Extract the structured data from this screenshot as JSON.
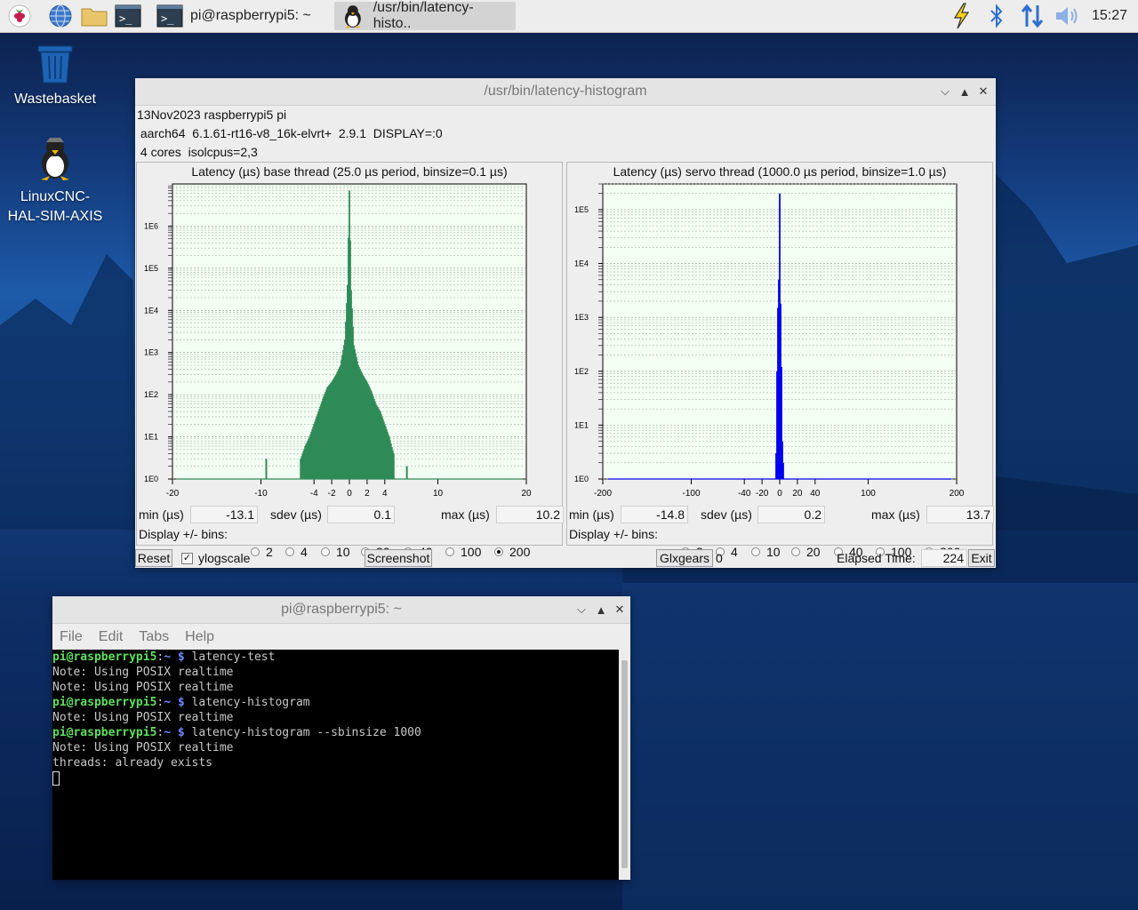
{
  "taskbar": {
    "terminal_task_label": "pi@raspberrypi5: ~",
    "histogram_task_label": "/usr/bin/latency-histo..",
    "clock": "15:27",
    "tray_icons": [
      "lightning-icon",
      "bluetooth-icon",
      "network-icon",
      "volume-icon"
    ]
  },
  "desktop": {
    "wastebasket_label": "Wastebasket",
    "linuxcnc_label_line1": "LinuxCNC-",
    "linuxcnc_label_line2": "HAL-SIM-AXIS"
  },
  "histogram_window": {
    "title": "/usr/bin/latency-histogram",
    "info_line1": "13Nov2023 raspberrypi5 pi",
    "info_line2": " aarch64  6.1.61-rt16-v8_16k-elvrt+  2.9.1  DISPLAY=:0",
    "info_line3": " 4 cores  isolcpus=2,3",
    "base": {
      "title": "Latency (µs) base thread (25.0 µs period, binsize=0.1 µs)",
      "min_label": "min (µs)",
      "min_value": "-13.1",
      "sdev_label": "sdev (µs)",
      "sdev_value": "0.1",
      "max_label": "max (µs)",
      "max_value": "10.2",
      "bins_label": "Display +/- bins:",
      "bins_options": [
        "2",
        "4",
        "10",
        "20",
        "40",
        "100",
        "200"
      ],
      "bins_selected": "200",
      "color": "#2e8b57"
    },
    "servo": {
      "title": "Latency (µs) servo thread (1000.0 µs period, binsize=1.0 µs)",
      "min_label": "min (µs)",
      "min_value": "-14.8",
      "sdev_label": "sdev (µs)",
      "sdev_value": "0.2",
      "max_label": "max (µs)",
      "max_value": "13.7",
      "bins_label": "Display +/- bins:",
      "bins_options": [
        "2",
        "4",
        "10",
        "20",
        "40",
        "100",
        "200"
      ],
      "bins_selected": "200",
      "color": "#0000ee"
    },
    "reset_label": "Reset",
    "ylogscale_label": "ylogscale",
    "ylogscale_checked": true,
    "screenshot_label": "Screenshot",
    "glxgears_label": "Glxgears",
    "glxgears_value": "0",
    "elapsed_label": "Elapsed Time:",
    "elapsed_value": "224",
    "exit_label": "Exit"
  },
  "chart_data": [
    {
      "type": "bar",
      "title": "Latency (µs) base thread (25.0 µs period, binsize=0.1 µs)",
      "y_scale": "log",
      "y_ticks": [
        "1E0",
        "1E1",
        "1E2",
        "1E3",
        "1E4",
        "1E5",
        "1E6"
      ],
      "x_ticks": [
        "-20",
        "-10",
        "-4",
        "-2",
        "0",
        "2",
        "4",
        "10",
        "20"
      ],
      "xlim": [
        -20,
        20
      ],
      "ylim": [
        1,
        10000000
      ],
      "grid": true,
      "series": [
        {
          "x": [
            -20,
            -13.1,
            -9.4,
            -5.5,
            -5,
            -4.5,
            -4,
            -3.5,
            -3,
            -2.5,
            -2,
            -1.5,
            -1,
            -0.5,
            -0.2,
            0,
            0.2,
            0.5,
            1,
            1.5,
            2,
            2.5,
            3,
            3.5,
            4,
            4.5,
            5,
            6.5,
            8.5,
            10.2,
            20
          ],
          "y": [
            1,
            1,
            3,
            3,
            6,
            10,
            20,
            40,
            80,
            150,
            200,
            300,
            500,
            2000,
            40000,
            7000000,
            30000,
            1500,
            500,
            300,
            200,
            120,
            60,
            40,
            20,
            10,
            4,
            2,
            1,
            1,
            1
          ]
        }
      ]
    },
    {
      "type": "bar",
      "title": "Latency (µs) servo thread (1000.0 µs period, binsize=1.0 µs)",
      "y_scale": "log",
      "y_ticks": [
        "1E0",
        "1E1",
        "1E2",
        "1E3",
        "1E4",
        "1E5"
      ],
      "x_ticks": [
        "-200",
        "-100",
        "-40",
        "-20",
        "0",
        "20",
        "40",
        "100",
        "200"
      ],
      "xlim": [
        -200,
        200
      ],
      "ylim": [
        1,
        300000
      ],
      "grid": true,
      "series": [
        {
          "x": [
            -200,
            -14.8,
            -4,
            -3,
            -2,
            -1,
            0,
            1,
            2,
            3,
            4,
            13.7,
            200
          ],
          "y": [
            1,
            1,
            3,
            100,
            1500,
            5000,
            200000,
            1800,
            120,
            5,
            2,
            1,
            1
          ]
        }
      ]
    }
  ],
  "terminal_window": {
    "title": "pi@raspberrypi5: ~",
    "menu": [
      "File",
      "Edit",
      "Tabs",
      "Help"
    ],
    "prompt_user": "pi@raspberrypi5",
    "prompt_sep": ":",
    "prompt_path": "~ $",
    "lines": [
      {
        "kind": "cmd",
        "text": " latency-test"
      },
      {
        "kind": "out",
        "text": "Note: Using POSIX realtime"
      },
      {
        "kind": "out",
        "text": "Note: Using POSIX realtime"
      },
      {
        "kind": "cmd",
        "text": " latency-histogram"
      },
      {
        "kind": "out",
        "text": "Note: Using POSIX realtime"
      },
      {
        "kind": "cmd",
        "text": " latency-histogram --sbinsize 1000"
      },
      {
        "kind": "out",
        "text": "Note: Using POSIX realtime"
      },
      {
        "kind": "out",
        "text": "threads: already exists"
      }
    ]
  }
}
